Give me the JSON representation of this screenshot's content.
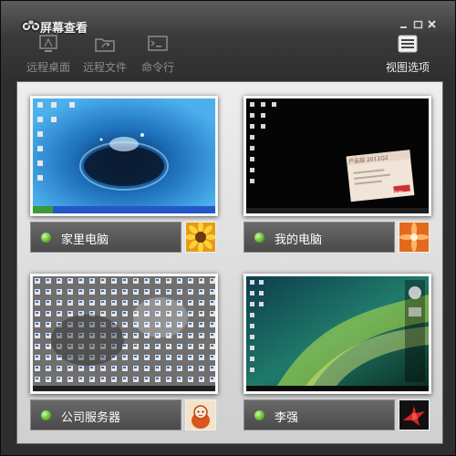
{
  "window": {
    "title": "屏幕查看",
    "controls": [
      "minimize",
      "maximize",
      "close"
    ]
  },
  "toolbar": {
    "remote_desktop": "远程桌面",
    "remote_files": "远程文件",
    "command_line": "命令行",
    "view_options": "视图选项"
  },
  "computers": [
    {
      "name": "家里电脑",
      "status": "online",
      "status_color": "#62b52e",
      "screen": "blue water drop wallpaper",
      "avatar": "sunflower"
    },
    {
      "name": "我的电脑",
      "status": "online",
      "status_color": "#62b52e",
      "screen": "black desktop with popup",
      "avatar": "orange flower"
    },
    {
      "name": "公司服务器",
      "status": "online",
      "status_color": "#62b52e",
      "screen": "grey desktop full of icons",
      "avatar": "doll"
    },
    {
      "name": "李强",
      "status": "online",
      "status_color": "#62b52e",
      "screen": "vista green aurora wallpaper",
      "avatar": "paper crane"
    }
  ],
  "popup": {
    "title": "产品部",
    "period": "2011Q2",
    "brand": "Oray"
  },
  "accent": {
    "status": "#62b52e",
    "chrome": "#3a3a3a",
    "panel": "#e0e0e0"
  }
}
